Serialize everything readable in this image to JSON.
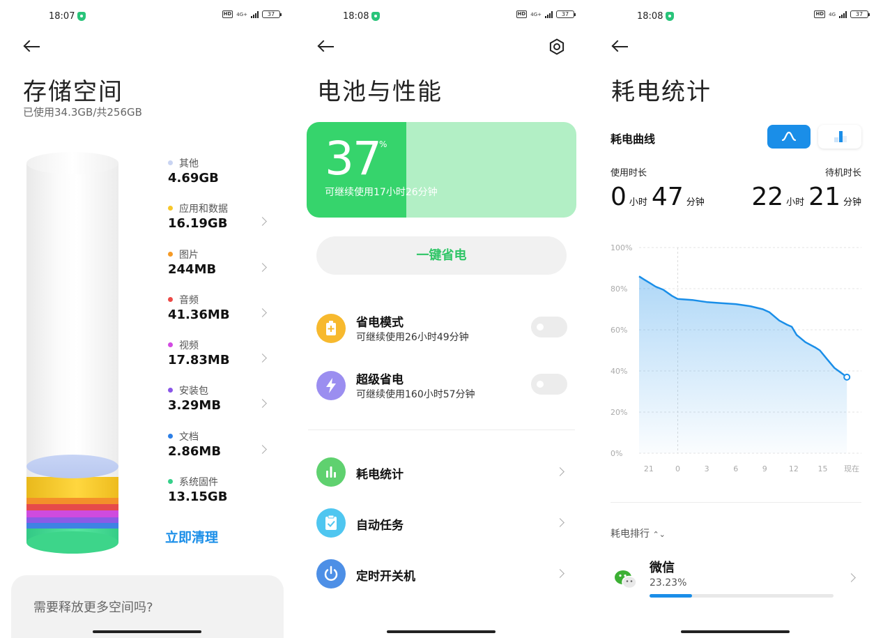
{
  "screen1": {
    "status_time": "18:07",
    "status_net": "4G+",
    "status_battery": "37",
    "title": "存储空间",
    "subtitle": "已使用34.3GB/共256GB",
    "categories": [
      {
        "label": "其他",
        "value": "4.69GB",
        "color": "#c9d4f2",
        "has_chevron": false
      },
      {
        "label": "应用和数据",
        "value": "16.19GB",
        "color": "#f7c72a",
        "has_chevron": true
      },
      {
        "label": "图片",
        "value": "244MB",
        "color": "#f59a26",
        "has_chevron": true
      },
      {
        "label": "音频",
        "value": "41.36MB",
        "color": "#ec4a47",
        "has_chevron": true
      },
      {
        "label": "视频",
        "value": "17.83MB",
        "color": "#d24be2",
        "has_chevron": true
      },
      {
        "label": "安装包",
        "value": "3.29MB",
        "color": "#8a56e8",
        "has_chevron": true
      },
      {
        "label": "文档",
        "value": "2.86MB",
        "color": "#2d7fe6",
        "has_chevron": true
      },
      {
        "label": "系统固件",
        "value": "13.15GB",
        "color": "#36d08a",
        "has_chevron": false
      }
    ],
    "clean_button": "立即清理",
    "more_card_text": "需要释放更多空间吗?"
  },
  "screen2": {
    "status_time": "18:08",
    "status_net": "4G+",
    "status_battery": "37",
    "title": "电池与性能",
    "battery_percent": "37",
    "percent_sign": "%",
    "battery_level": 0.37,
    "remaining_text": "可继续使用17小时26分钟",
    "one_key_save": "一键省电",
    "modes": [
      {
        "title": "省电模式",
        "subtitle": "可继续使用26小时49分钟",
        "icon": "battery-plus-icon",
        "color": "#f7b92e",
        "enabled": false
      },
      {
        "title": "超级省电",
        "subtitle": "可继续使用160小时57分钟",
        "icon": "lightning-icon",
        "color": "#9b8ef0",
        "enabled": false
      }
    ],
    "menu": [
      {
        "title": "耗电统计",
        "icon": "bar-chart-icon",
        "color": "#5fd16f"
      },
      {
        "title": "自动任务",
        "icon": "clipboard-check-icon",
        "color": "#4fc6f0"
      },
      {
        "title": "定时开关机",
        "icon": "power-icon",
        "color": "#4d8fe6"
      }
    ]
  },
  "screen3": {
    "status_time": "18:08",
    "status_net": "4G",
    "status_battery": "37",
    "title": "耗电统计",
    "curve_label": "耗电曲线",
    "usage_label": "使用时长",
    "standby_label": "待机时长",
    "usage": {
      "hours": "0",
      "hour_unit": "小时",
      "minutes": "47",
      "minute_unit": "分钟"
    },
    "standby": {
      "hours": "22",
      "hour_unit": "小时",
      "minutes": "21",
      "minute_unit": "分钟"
    },
    "rank_label": "耗电排行",
    "apps": [
      {
        "name": "微信",
        "percent": "23.23%",
        "share": 0.2323
      }
    ]
  },
  "chart_data": {
    "type": "area",
    "title": "",
    "xlabel": "",
    "ylabel": "",
    "y_ticks": [
      "100%",
      "80%",
      "60%",
      "40%",
      "20%",
      "0%"
    ],
    "x_ticks": [
      "21",
      "0",
      "3",
      "6",
      "9",
      "12",
      "15",
      "现在"
    ],
    "ylim": [
      0,
      100
    ],
    "grid": true,
    "color": "#1a8ee8",
    "series": [
      {
        "x": [
          -4,
          -3.5,
          -2.8,
          -2.3,
          -1.5,
          -0.6,
          0,
          1.5,
          3,
          4.5,
          6,
          7.5,
          8.8,
          9.5,
          10.5,
          11.3,
          11.8,
          12.3,
          13.2,
          14.2,
          14.7,
          15.4,
          16.2,
          17.5
        ],
        "y": [
          86,
          84.5,
          82.5,
          81,
          79.5,
          76.5,
          75,
          74.5,
          73.5,
          73,
          72.5,
          71.5,
          70,
          68.5,
          64.5,
          62.5,
          61.5,
          57.5,
          54,
          51.5,
          50,
          46,
          41.5,
          37
        ]
      }
    ]
  }
}
